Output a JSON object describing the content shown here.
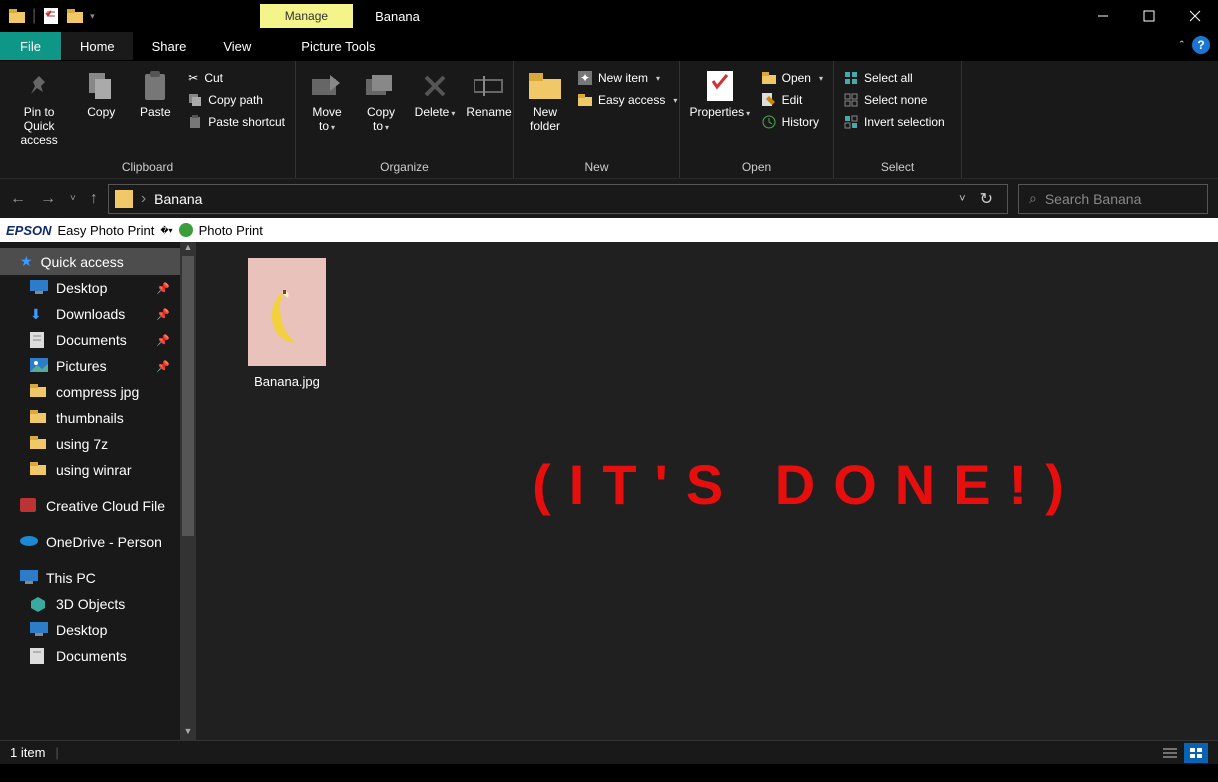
{
  "title": "Banana",
  "context_tab": "Manage",
  "tabs": {
    "file": "File",
    "home": "Home",
    "share": "Share",
    "view": "View",
    "picture_tools": "Picture Tools"
  },
  "ribbon": {
    "clipboard": {
      "label": "Clipboard",
      "pin": "Pin to Quick access",
      "copy": "Copy",
      "paste": "Paste",
      "cut": "Cut",
      "copy_path": "Copy path",
      "paste_shortcut": "Paste shortcut"
    },
    "organize": {
      "label": "Organize",
      "move_to": "Move to",
      "copy_to": "Copy to",
      "delete": "Delete",
      "rename": "Rename"
    },
    "new": {
      "label": "New",
      "new_folder": "New folder",
      "new_item": "New item",
      "easy_access": "Easy access"
    },
    "open": {
      "label": "Open",
      "properties": "Properties",
      "open": "Open",
      "edit": "Edit",
      "history": "History"
    },
    "select": {
      "label": "Select",
      "select_all": "Select all",
      "select_none": "Select none",
      "invert": "Invert selection"
    }
  },
  "address": {
    "path": "Banana"
  },
  "search": {
    "placeholder": "Search Banana"
  },
  "epson": {
    "brand": "EPSON",
    "easy": "Easy Photo Print",
    "photo": "Photo Print"
  },
  "sidebar": {
    "quick_access": "Quick access",
    "desktop": "Desktop",
    "downloads": "Downloads",
    "documents": "Documents",
    "pictures": "Pictures",
    "compress": "compress jpg",
    "thumbnails": "thumbnails",
    "using7z": "using 7z",
    "usingwinrar": "using winrar",
    "cc": "Creative Cloud File",
    "onedrive": "OneDrive - Person",
    "thispc": "This PC",
    "threed": "3D Objects",
    "desktop2": "Desktop",
    "documents2": "Documents"
  },
  "file": {
    "name": "Banana.jpg"
  },
  "overlay": "(IT'S DONE!)",
  "status": {
    "count": "1 item"
  }
}
